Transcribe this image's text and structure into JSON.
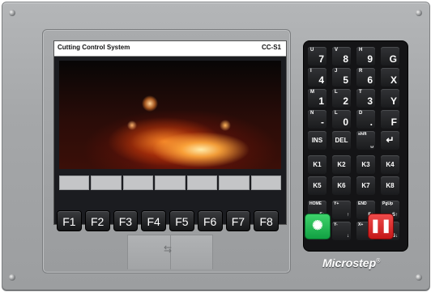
{
  "screen": {
    "title": "Cutting Control System",
    "model": "CC-S1"
  },
  "function_keys": [
    "F1",
    "F2",
    "F3",
    "F4",
    "F5",
    "F6",
    "F7",
    "F8"
  ],
  "keypad": {
    "row1": [
      {
        "sup": "U",
        "main": "7"
      },
      {
        "sup": "V",
        "main": "8"
      },
      {
        "sup": "H",
        "main": "9"
      },
      {
        "sup": "",
        "main": "G"
      }
    ],
    "row2": [
      {
        "sup": "I",
        "main": "4"
      },
      {
        "sup": "J",
        "main": "5"
      },
      {
        "sup": "R",
        "main": "6"
      },
      {
        "sup": "",
        "main": "X"
      }
    ],
    "row3": [
      {
        "sup": "M",
        "main": "1"
      },
      {
        "sup": "L",
        "main": "2"
      },
      {
        "sup": "T",
        "main": "3"
      },
      {
        "sup": "",
        "main": "Y"
      }
    ],
    "row4": [
      {
        "sup": "N",
        "main": "-"
      },
      {
        "sup": "L",
        "main": "0"
      },
      {
        "sup": "D",
        "main": "."
      },
      {
        "sup": "",
        "main": "F"
      }
    ],
    "row5": [
      "INS",
      "DEL",
      "shift",
      "↵"
    ],
    "k_row1": [
      "K1",
      "K2",
      "K3",
      "K4"
    ],
    "k_row2": [
      "K5",
      "K6",
      "K7",
      "K8"
    ],
    "nav_row1": [
      {
        "top": "HOME",
        "bot": "F↑"
      },
      {
        "top": "Y+",
        "bot": "↑"
      },
      {
        "top": "END",
        "bot": "F↓"
      },
      {
        "top": "PgUp",
        "bot": "S↑"
      }
    ],
    "nav_row2": [
      {
        "top": "X-",
        "bot": "←"
      },
      {
        "top": "Y-",
        "bot": "↓"
      },
      {
        "top": "X+",
        "bot": "→"
      },
      {
        "top": "PgDn",
        "bot": "S↓"
      }
    ]
  },
  "start_icon": "start-sparkle-icon",
  "stop_icon": "pause-icon",
  "usb_icon": "usb-icon",
  "brand": "Microstep",
  "brand_mark": "®",
  "colors": {
    "start": "#12a143",
    "stop": "#c41717",
    "panel": "#a5a7a9",
    "keys": "#1a1b1d"
  }
}
